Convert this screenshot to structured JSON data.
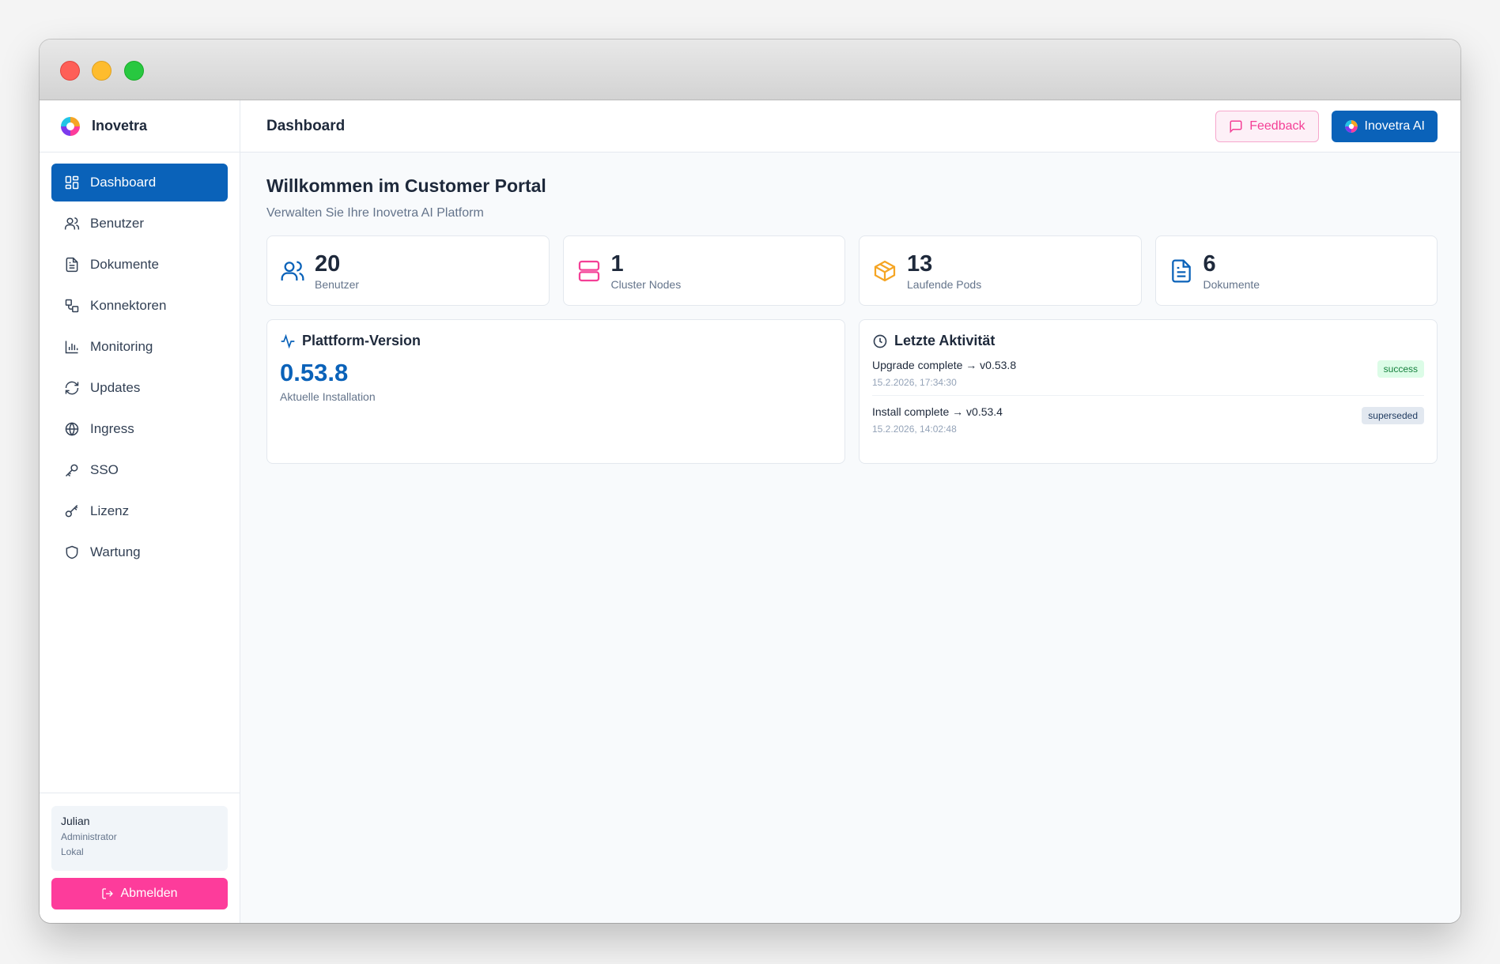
{
  "brand": {
    "name": "Inovetra"
  },
  "sidebar": {
    "items": [
      {
        "label": "Dashboard",
        "icon": "dashboard-icon",
        "active": true
      },
      {
        "label": "Benutzer",
        "icon": "users-icon"
      },
      {
        "label": "Dokumente",
        "icon": "document-icon"
      },
      {
        "label": "Konnektoren",
        "icon": "connector-icon"
      },
      {
        "label": "Monitoring",
        "icon": "bar-chart-icon"
      },
      {
        "label": "Updates",
        "icon": "refresh-icon"
      },
      {
        "label": "Ingress",
        "icon": "globe-icon"
      },
      {
        "label": "SSO",
        "icon": "key-icon"
      },
      {
        "label": "Lizenz",
        "icon": "license-key-icon"
      },
      {
        "label": "Wartung",
        "icon": "shield-icon"
      }
    ]
  },
  "user": {
    "name": "Julian",
    "role": "Administrator",
    "source": "Lokal"
  },
  "logout_label": "Abmelden",
  "header": {
    "title": "Dashboard",
    "feedback_label": "Feedback",
    "ai_label": "Inovetra AI"
  },
  "welcome": {
    "title": "Willkommen im Customer Portal",
    "subtitle": "Verwalten Sie Ihre Inovetra AI Platform"
  },
  "stats": [
    {
      "value": "20",
      "label": "Benutzer",
      "icon": "users-icon",
      "color": "#0a62b9"
    },
    {
      "value": "1",
      "label": "Cluster Nodes",
      "icon": "server-icon",
      "color": "#f43f96"
    },
    {
      "value": "13",
      "label": "Laufende Pods",
      "icon": "package-icon",
      "color": "#f5a524"
    },
    {
      "value": "6",
      "label": "Dokumente",
      "icon": "document-icon",
      "color": "#0a62b9"
    }
  ],
  "version": {
    "title": "Plattform-Version",
    "value": "0.53.8",
    "label": "Aktuelle Installation"
  },
  "activity": {
    "title": "Letzte Aktivität",
    "items": [
      {
        "title": "Upgrade complete → v0.53.8",
        "time": "15.2.2026, 17:34:30",
        "status": "success"
      },
      {
        "title": "Install complete → v0.53.4",
        "time": "15.2.2026, 14:02:48",
        "status": "superseded"
      }
    ]
  },
  "colors": {
    "primary": "#0a62b9",
    "accent_pink": "#fd3c9b",
    "success_bg": "#dcfce7",
    "success_text": "#15803d"
  }
}
